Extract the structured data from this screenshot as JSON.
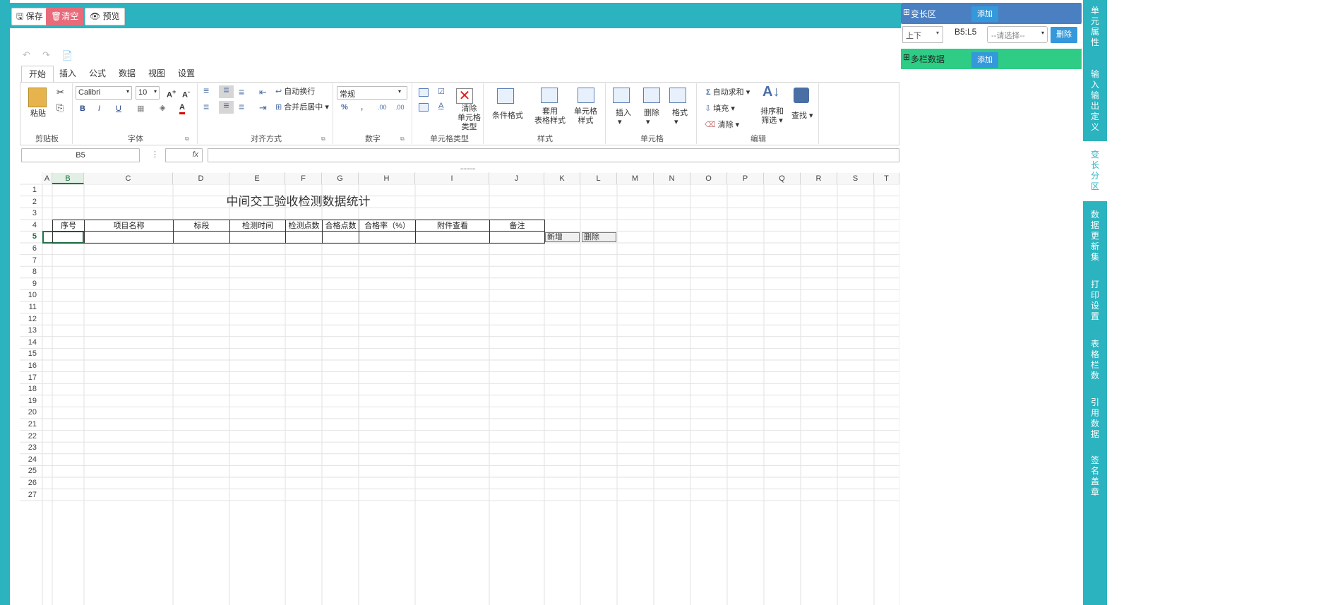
{
  "toolbar": {
    "save": "保存",
    "clear": "清空",
    "preview": "预览"
  },
  "ribbon_tabs": [
    "开始",
    "插入",
    "公式",
    "数据",
    "视图",
    "设置"
  ],
  "ribbon": {
    "paste": "粘贴",
    "font_name": "Calibri",
    "font_size": "10",
    "wrap_text": "自动换行",
    "merge_center": "合并后居中",
    "number_format": "常规",
    "clear_cell_type": [
      "清除",
      "单元格",
      "类型"
    ],
    "conditional_format": "条件格式",
    "table_style": [
      "套用",
      "表格样式"
    ],
    "cell_style": [
      "单元格",
      "样式"
    ],
    "insert": "插入",
    "delete": "删除",
    "format": "格式",
    "autosum": "自动求和",
    "fill": "填充",
    "clear": "清除",
    "sort_filter": [
      "排序和",
      "筛选"
    ],
    "find": "查找",
    "groups": [
      "剪贴板",
      "字体",
      "对齐方式",
      "数字",
      "单元格类型",
      "样式",
      "单元格",
      "编辑"
    ]
  },
  "formula_bar": {
    "name_box": "B5",
    "fx": "fx"
  },
  "columns": [
    "A",
    "B",
    "C",
    "D",
    "E",
    "F",
    "G",
    "H",
    "I",
    "J",
    "K",
    "L",
    "M",
    "N",
    "O",
    "P",
    "Q",
    "R",
    "S",
    "T"
  ],
  "rows": [
    "1",
    "2",
    "3",
    "4",
    "5",
    "6",
    "7",
    "8",
    "9",
    "10",
    "11",
    "12",
    "13",
    "14",
    "15",
    "16",
    "17",
    "18",
    "19",
    "20",
    "21",
    "22",
    "23",
    "24",
    "25",
    "26",
    "27"
  ],
  "sheet": {
    "title": "中间交工验收检测数据统计",
    "headers": [
      "序号",
      "项目名称",
      "标段",
      "检测时间",
      "检测点数",
      "合格点数",
      "合格率（%）",
      "附件查看",
      "备注"
    ],
    "buttons": [
      "新增",
      "删除"
    ]
  },
  "right_panel": {
    "variable_area": "变长区",
    "add": "添加",
    "direction": "上下",
    "range": "B5:L5",
    "select_placeholder": "--请选择--",
    "delete": "删除",
    "multi_column": "多栏数据",
    "add2": "添加"
  },
  "side_tabs": [
    "单元属性",
    "输入输出定义",
    "变长分区",
    "数据更新集",
    "打印设置",
    "表格栏数",
    "引用数据",
    "签名盖章"
  ],
  "colors": {
    "teal": "#2bb3c0",
    "green": "#2ecc85",
    "blue_header": "#4a7fc1",
    "accent": "#217346"
  }
}
